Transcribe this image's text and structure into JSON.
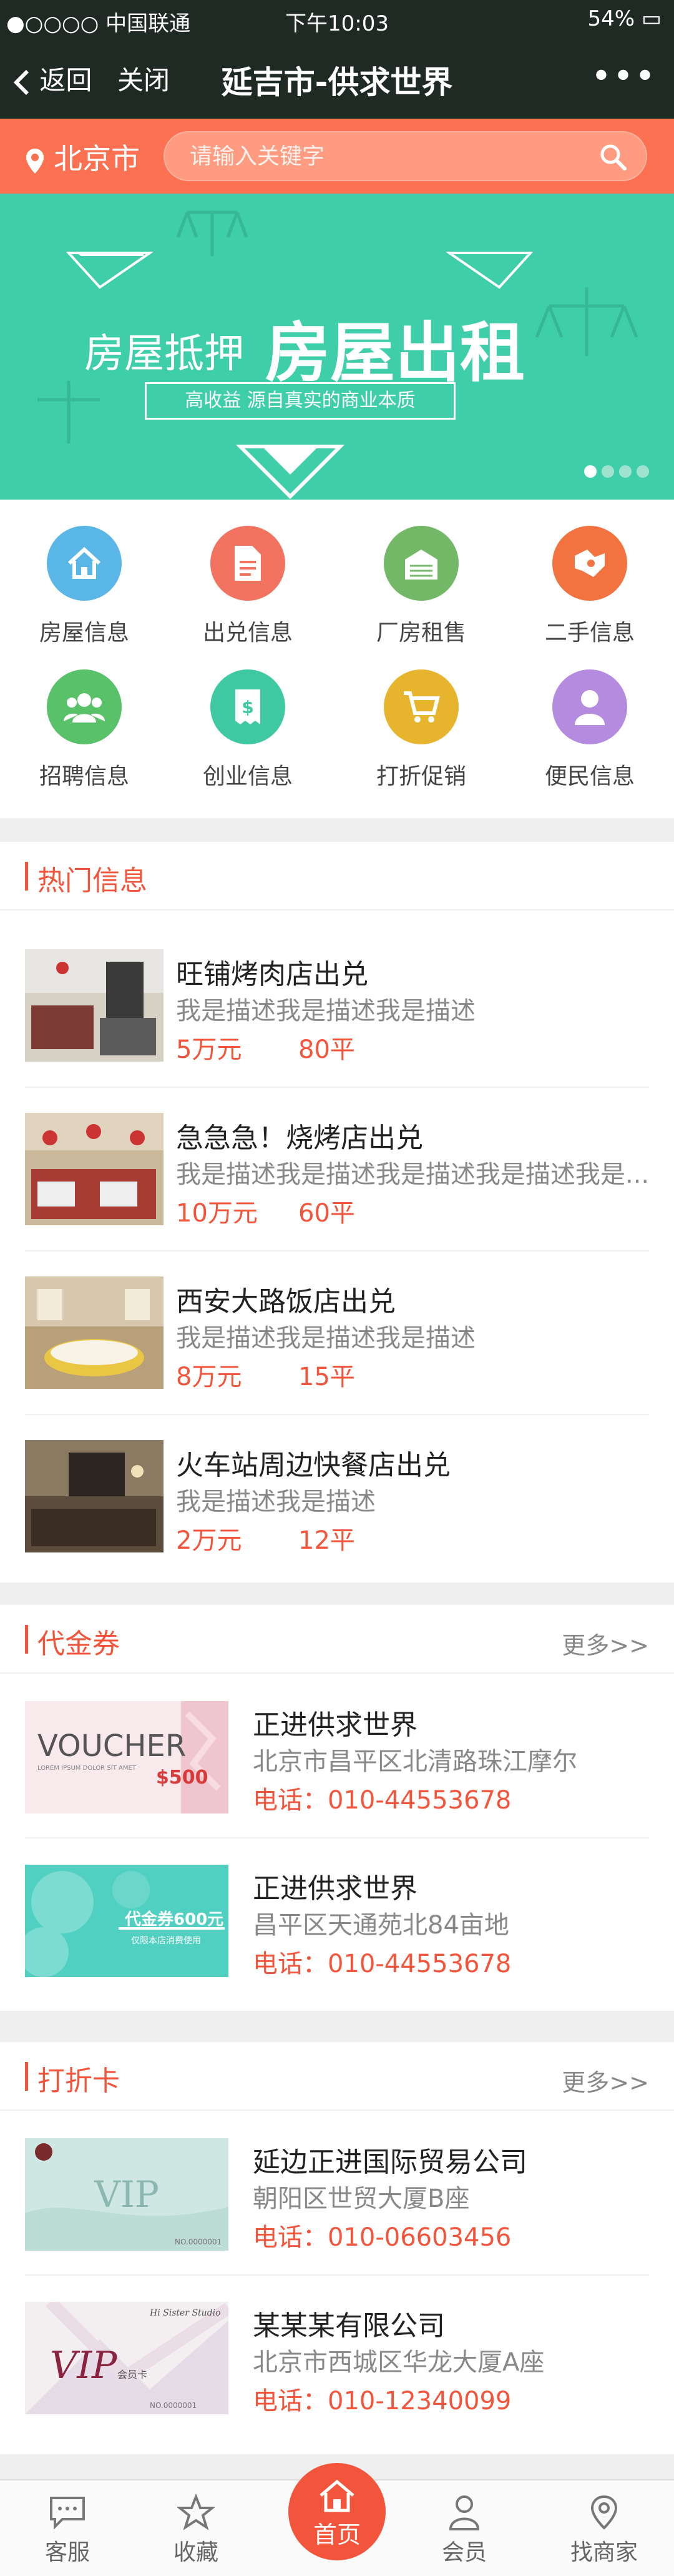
{
  "status_bar": {
    "carrier": "●○○○○ 中国联通",
    "time": "下午10:03",
    "battery": "54%"
  },
  "header": {
    "back_label": "返回",
    "close_label": "关闭",
    "title": "延吉市-供求世界",
    "more_label": "•••"
  },
  "search": {
    "city": "北京市",
    "placeholder": "请输入关键字"
  },
  "banner": {
    "text_small": "房屋抵押",
    "text_big": "房屋出租",
    "subtitle": "高收益 源自真实的商业本质",
    "dots": 4,
    "active_dot": 0
  },
  "categories": [
    {
      "label": "房屋信息",
      "color": "#5ab6e6",
      "icon": "house-icon"
    },
    {
      "label": "出兑信息",
      "color": "#f27260",
      "icon": "document-icon"
    },
    {
      "label": "厂房租售",
      "color": "#72b866",
      "icon": "factory-icon"
    },
    {
      "label": "二手信息",
      "color": "#f2733f",
      "icon": "handshake-icon"
    },
    {
      "label": "招聘信息",
      "color": "#59c167",
      "icon": "people-icon"
    },
    {
      "label": "创业信息",
      "color": "#3fc9a2",
      "icon": "receipt-icon"
    },
    {
      "label": "打折促销",
      "color": "#e7b52d",
      "icon": "cart-icon"
    },
    {
      "label": "便民信息",
      "color": "#b58be0",
      "icon": "person-icon"
    }
  ],
  "hot": {
    "title": "热门信息",
    "items": [
      {
        "title": "旺铺烤肉店出兑",
        "desc": "我是描述我是描述我是描述",
        "price": "5万元",
        "area": "80平"
      },
      {
        "title": "急急急！烧烤店出兑",
        "desc": "我是描述我是描述我是描述我是描述我是...",
        "price": "10万元",
        "area": "60平"
      },
      {
        "title": "西安大路饭店出兑",
        "desc": "我是描述我是描述我是描述",
        "price": "8万元",
        "area": "15平"
      },
      {
        "title": "火车站周边快餐店出兑",
        "desc": "我是描述我是描述",
        "price": "2万元",
        "area": "12平"
      }
    ]
  },
  "vouchers": {
    "title": "代金券",
    "more": "更多>>",
    "items": [
      {
        "name": "正进供求世界",
        "address": "北京市昌平区北清路珠江摩尔",
        "phone": "电话：010-44553678",
        "img_big": "VOUCHER",
        "img_amount": "$500",
        "img_small": "LOREM IPSUM DOLOR SIT AMET"
      },
      {
        "name": "正进供求世界",
        "address": "昌平区天通苑北84亩地",
        "phone": "电话：010-44553678",
        "img_big": "代金券600元",
        "img_small": "仅限本店消费使用"
      }
    ]
  },
  "discount": {
    "title": "打折卡",
    "more": "更多>>",
    "items": [
      {
        "name": "延边正进国际贸易公司",
        "address": "朝阳区世贸大厦B座",
        "phone": "电话：010-06603456",
        "img_big": "VIP",
        "img_no": "NO.0000001"
      },
      {
        "name": "某某某有限公司",
        "address": "北京市西城区华龙大厦A座",
        "phone": "电话：010-12340099",
        "img_big": "VIP",
        "img_card": "会员卡",
        "img_brand": "Hi Sister Studio",
        "img_no": "NO.0000001"
      }
    ]
  },
  "nav": [
    {
      "label": "客服",
      "icon": "chat-icon"
    },
    {
      "label": "收藏",
      "icon": "star-icon"
    },
    {
      "label": "首页",
      "icon": "home-icon"
    },
    {
      "label": "会员",
      "icon": "user-icon"
    },
    {
      "label": "找商家",
      "icon": "location-icon"
    }
  ]
}
